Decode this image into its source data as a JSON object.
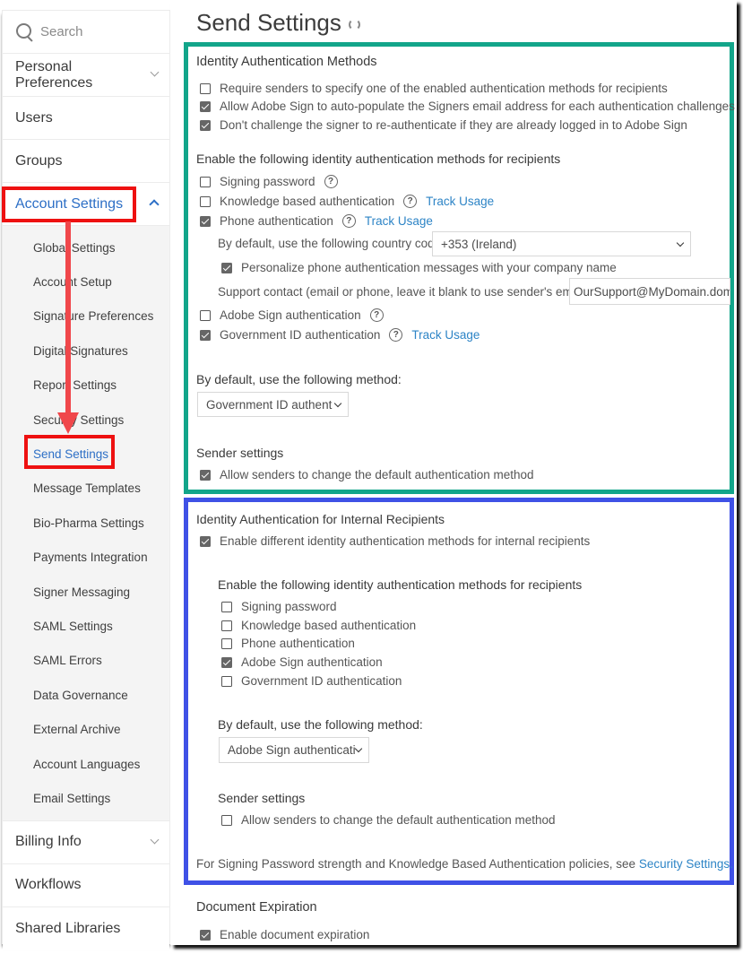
{
  "sidebar": {
    "search_placeholder": "Search",
    "top_items": [
      {
        "label": "Personal Preferences",
        "expandable": true,
        "expanded": false
      },
      {
        "label": "Users"
      },
      {
        "label": "Groups"
      },
      {
        "label": "Account Settings",
        "expandable": true,
        "expanded": true,
        "active": true
      }
    ],
    "account_settings_items": [
      {
        "label": "Global Settings"
      },
      {
        "label": "Account Setup"
      },
      {
        "label": "Signature Preferences"
      },
      {
        "label": "Digital Signatures"
      },
      {
        "label": "Report Settings"
      },
      {
        "label": "Security Settings"
      },
      {
        "label": "Send Settings",
        "active": true
      },
      {
        "label": "Message Templates"
      },
      {
        "label": "Bio-Pharma Settings"
      },
      {
        "label": "Payments Integration"
      },
      {
        "label": "Signer Messaging"
      },
      {
        "label": "SAML Settings"
      },
      {
        "label": "SAML Errors"
      },
      {
        "label": "Data Governance"
      },
      {
        "label": "External Archive"
      },
      {
        "label": "Account Languages"
      },
      {
        "label": "Email Settings"
      }
    ],
    "bottom_items": [
      {
        "label": "Billing Info",
        "expandable": true,
        "expanded": false
      },
      {
        "label": "Workflows"
      },
      {
        "label": "Shared Libraries"
      }
    ]
  },
  "page": {
    "title": "Send Settings"
  },
  "identity_auth": {
    "title": "Identity Authentication Methods",
    "options": [
      {
        "label": "Require senders to specify one of the enabled authentication methods for recipients",
        "checked": false
      },
      {
        "label": "Allow Adobe Sign to auto-populate the Signers email address for each authentication challenges",
        "checked": true
      },
      {
        "label": "Don't challenge the signer to re-authenticate if they are already logged in to Adobe Sign",
        "checked": true
      }
    ],
    "methods_title": "Enable the following identity authentication methods for recipients",
    "methods": [
      {
        "label": "Signing password",
        "checked": false,
        "help": true
      },
      {
        "label": "Knowledge based authentication",
        "checked": false,
        "help": true,
        "link": "Track Usage"
      },
      {
        "label": "Phone authentication",
        "checked": true,
        "help": true,
        "link": "Track Usage"
      },
      {
        "label": "Adobe Sign authentication",
        "checked": false,
        "help": true
      },
      {
        "label": "Government ID authentication",
        "checked": true,
        "help": true,
        "link": "Track Usage"
      }
    ],
    "phone": {
      "country_code_label": "By default, use the following country code:",
      "country_code_value": "+353 (Ireland)",
      "personalize_label": "Personalize phone authentication messages with your company name",
      "personalize_checked": true,
      "support_label": "Support contact (email or phone, leave it blank to use sender's email):",
      "support_value": "OurSupport@MyDomain.dom"
    },
    "default_method_label": "By default, use the following method:",
    "default_method_value": "Government ID authent",
    "sender_settings_title": "Sender settings",
    "sender_option": {
      "label": "Allow senders to change the default authentication method",
      "checked": true
    }
  },
  "internal_auth": {
    "title": "Identity Authentication for Internal Recipients",
    "enable_option": {
      "label": "Enable different identity authentication methods for internal recipients",
      "checked": true
    },
    "methods_title": "Enable the following identity authentication methods for recipients",
    "methods": [
      {
        "label": "Signing password",
        "checked": false
      },
      {
        "label": "Knowledge based authentication",
        "checked": false
      },
      {
        "label": "Phone authentication",
        "checked": false
      },
      {
        "label": "Adobe Sign authentication",
        "checked": true
      },
      {
        "label": "Government ID authentication",
        "checked": false
      }
    ],
    "default_method_label": "By default, use the following method:",
    "default_method_value": "Adobe Sign authenticati",
    "sender_settings_title": "Sender settings",
    "sender_option": {
      "label": "Allow senders to change the default authentication method",
      "checked": false
    },
    "footnote_text": "For Signing Password strength and Knowledge Based Authentication policies, see ",
    "footnote_link": "Security Settings."
  },
  "document_expiration": {
    "title": "Document Expiration",
    "option": {
      "label": "Enable document expiration",
      "checked": true
    }
  },
  "annotations": {
    "teal_box_color": "#12a58a",
    "blue_box_color": "#3f51e6",
    "red_highlight_color": "#ee1111"
  }
}
